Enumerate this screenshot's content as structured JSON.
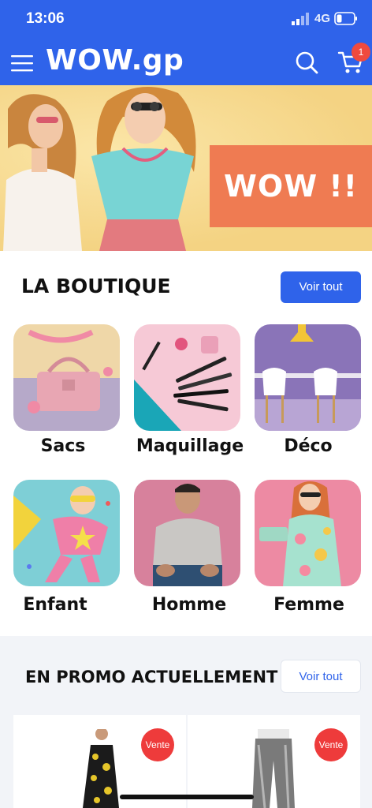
{
  "status_bar": {
    "time": "13:06",
    "network": "4G",
    "icons": [
      "signal-icon",
      "battery-icon"
    ]
  },
  "header": {
    "brand": "WOW.gp",
    "cart_count": "1",
    "icons": [
      "menu-icon",
      "search-icon",
      "cart-icon"
    ]
  },
  "hero": {
    "badge_text": "WOW !!"
  },
  "shop": {
    "title": "LA BOUTIQUE",
    "view_all_label": "Voir tout",
    "categories": [
      {
        "label": "Sacs"
      },
      {
        "label": "Maquillage"
      },
      {
        "label": "Déco"
      },
      {
        "label": "Enfant"
      },
      {
        "label": "Homme"
      },
      {
        "label": "Femme"
      }
    ]
  },
  "promo": {
    "title": "EN PROMO ACTUELLEMENT",
    "view_all_label": "Voir tout",
    "products": [
      {
        "badge": "Vente"
      },
      {
        "badge": "Vente"
      }
    ]
  },
  "colors": {
    "brand_blue": "#2f63ea",
    "hero_badge": "#ef7b52",
    "sale_red": "#ee3b3b",
    "cart_badge": "#f04a3e"
  }
}
